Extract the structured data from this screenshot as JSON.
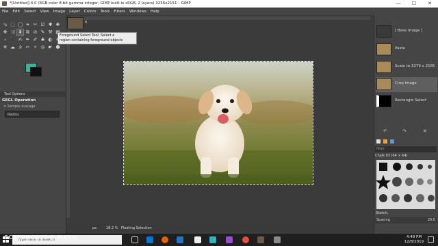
{
  "window": {
    "title": "*[Untitled]-4.0 (RGB color 8-bit gamma integer, GIMP built-in sRGB, 2 layers) 3256x2151 – GIMP",
    "minimize": "—",
    "maximize": "☐",
    "close": "✕"
  },
  "menu": [
    "File",
    "Edit",
    "Select",
    "View",
    "Image",
    "Layer",
    "Colors",
    "Tools",
    "Filters",
    "Windows",
    "Help"
  ],
  "toolbox": {
    "tools": [
      "⇘",
      "⬚",
      "◯",
      "❧",
      "✂",
      "☑",
      "✱",
      "✚",
      "✥",
      "⤨",
      "⬍",
      "⧉",
      "⊘",
      "✎",
      "⚒",
      "▦",
      "⬪",
      "⬛",
      "✍",
      "✒",
      "✐",
      "♣",
      "◐",
      "✸",
      "✵",
      "☁",
      "✰",
      "✂",
      "✧",
      "◎",
      "☛",
      "⬢"
    ],
    "fg_color": "#3bb39b",
    "bg_color": "#101010"
  },
  "tool_options": {
    "tab_label": "Tool Options",
    "gegl_operation": "GEGL Operation",
    "sample_average": "Sample average",
    "radius_label": "Radius"
  },
  "tooltip": {
    "line1": "Foreground Select Tool: Select a",
    "line2": "region containing foreground objects"
  },
  "recorded_with": "RECORDED WITH",
  "status": {
    "unit": "px",
    "zoom": "18.2 %",
    "message": "Floating Selection"
  },
  "history": [
    {
      "label": "[ Base Image ]",
      "thumb": "none"
    },
    {
      "label": "Paste",
      "thumb": "photo"
    },
    {
      "label": "Scale to 3279 x 2185",
      "thumb": "photo"
    },
    {
      "label": "Crop Image",
      "thumb": "photo"
    },
    {
      "label": "Rectangle Select",
      "thumb": "mask"
    }
  ],
  "brushes": {
    "filter_placeholder": "filter",
    "selected_brush": "Chalk 03 (64 × 64)",
    "tag": "Sketch,",
    "spacing_label": "Spacing",
    "spacing_value": "20.0"
  },
  "taskbar": {
    "search_placeholder": "Type here to search",
    "time": "4:49 PM",
    "date": "12/8/2019"
  },
  "watermark": "SCREENCAST-O-MATIC",
  "colors": {
    "accent": "#3bb39b",
    "panel": "#454545",
    "canvas_bg": "#3b3b3b"
  }
}
